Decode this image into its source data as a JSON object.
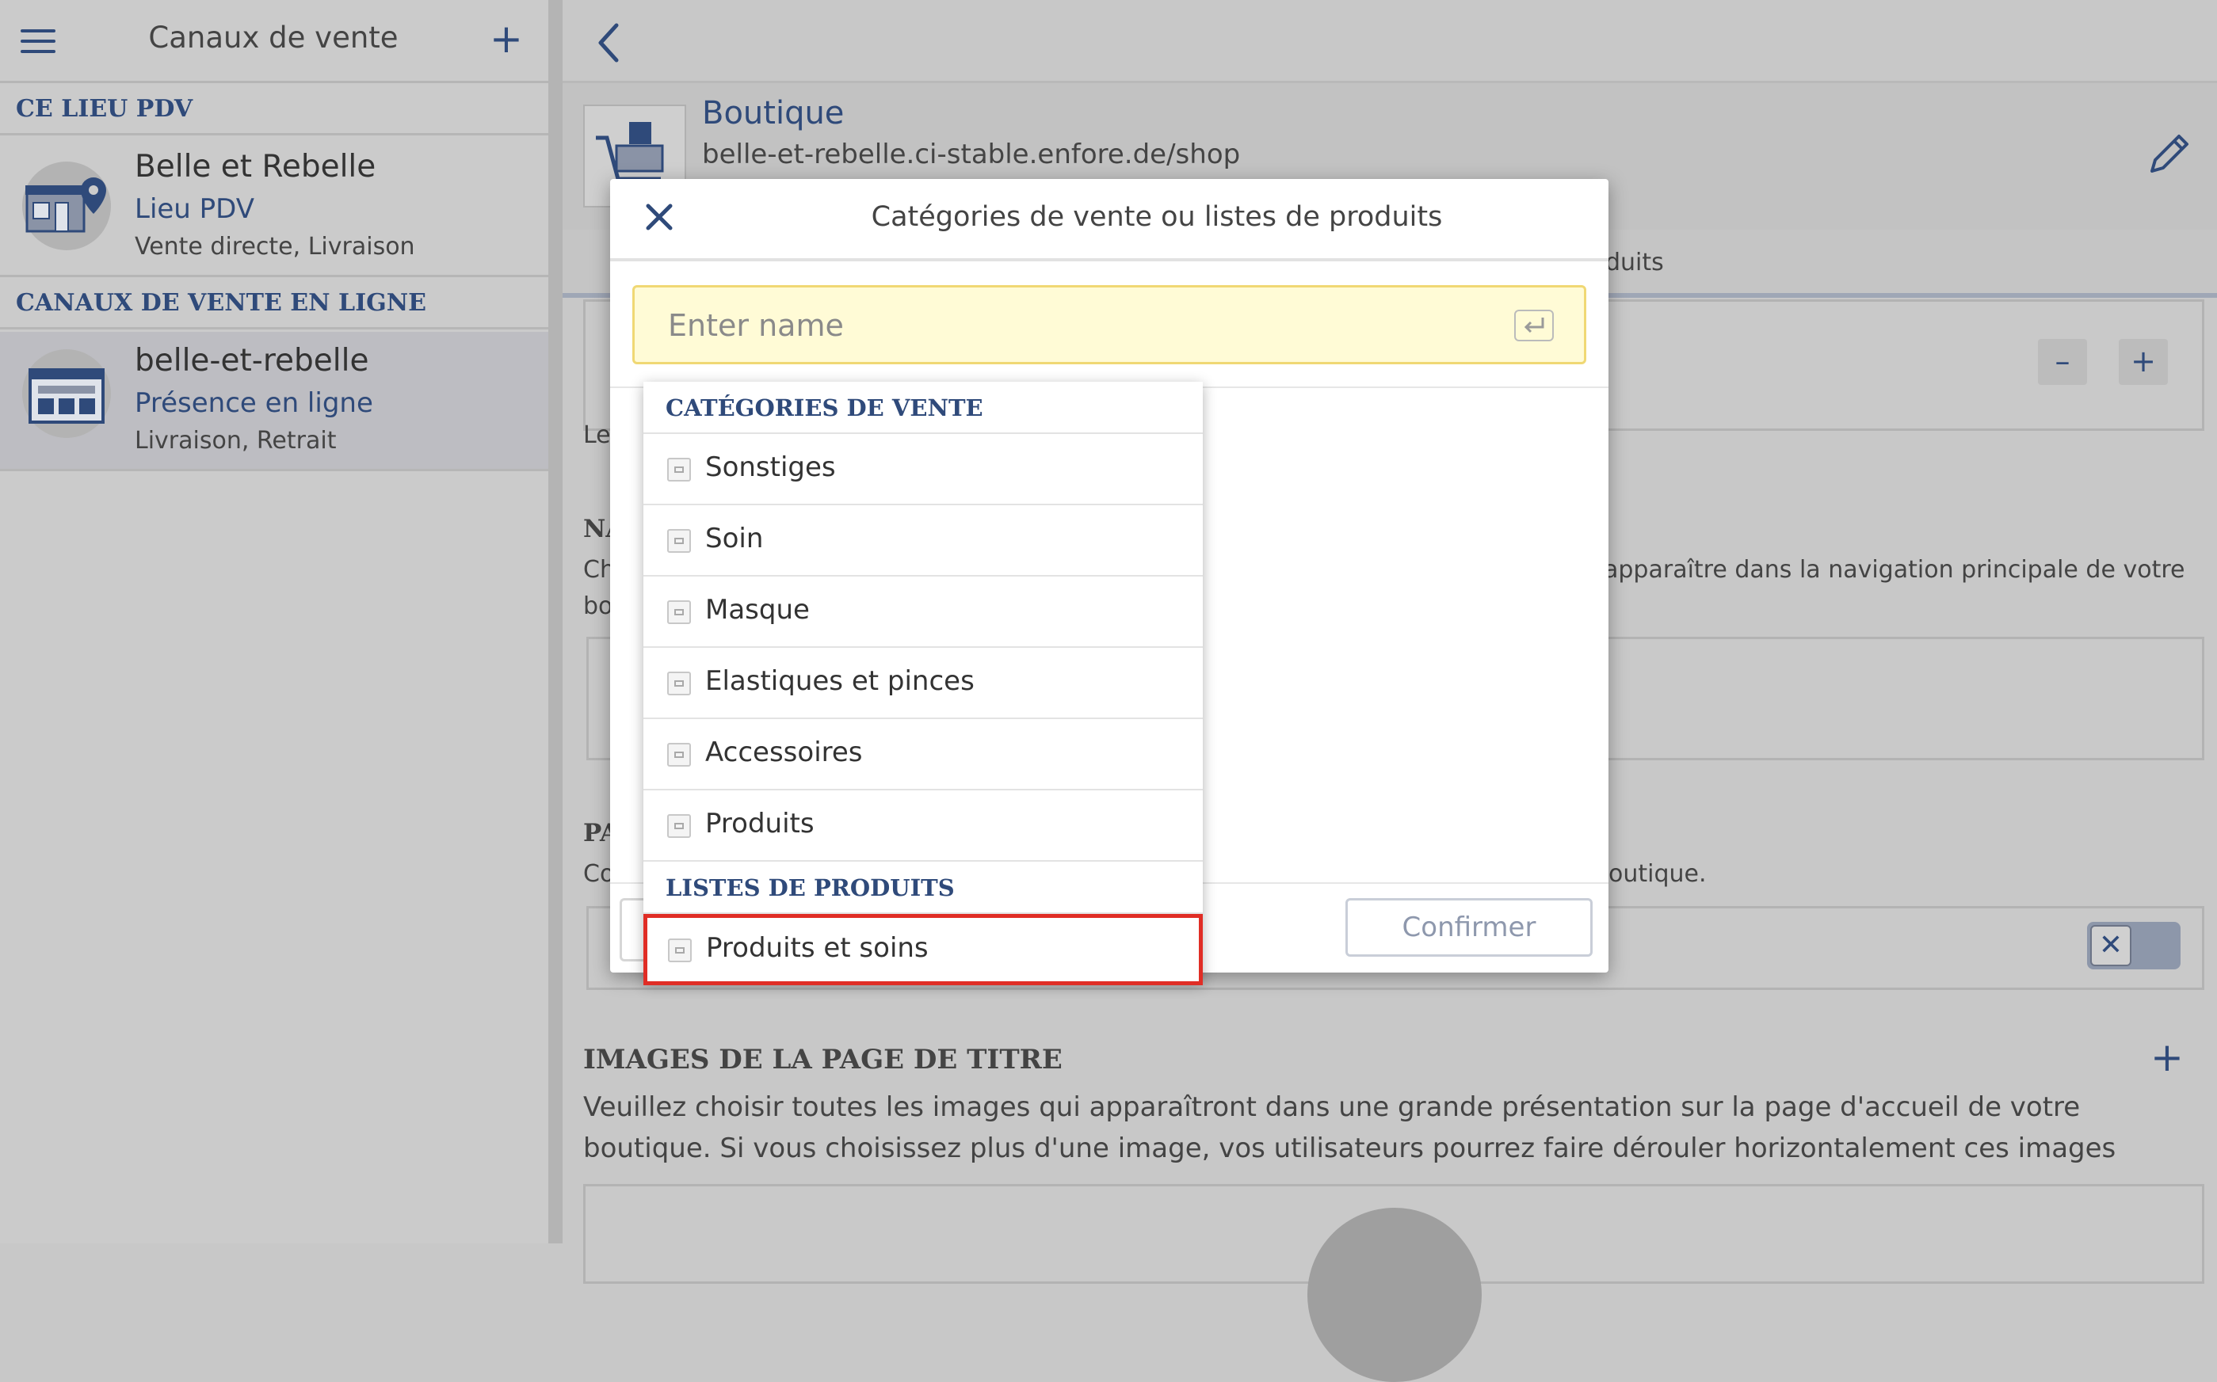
{
  "sidebar": {
    "title": "Canaux de vente",
    "add_label": "+",
    "section_pos": "CE LIEU PDV",
    "section_online": "CANAUX DE VENTE EN LIGNE",
    "items": [
      {
        "title": "Belle et Rebelle",
        "subtitle": "Lieu PDV",
        "meta": "Vente directe, Livraison"
      },
      {
        "title": "belle-et-rebelle",
        "subtitle": "Présence en ligne",
        "meta": "Livraison, Retrait"
      }
    ]
  },
  "main": {
    "shop_title": "Boutique",
    "shop_url": "belle-et-rebelle.ci-stable.enfore.de/shop",
    "tab_fragment": "duits",
    "stepper_minus": "–",
    "stepper_plus": "+",
    "frag_le": "Le",
    "frag_na": "NA",
    "frag_ch": "Ch",
    "frag_bo": "bo",
    "nav_desc_fragment": "apparaître dans la navigation principale de votre",
    "frag_pa": "PA",
    "frag_co": "Co",
    "boutique_fragment": "outique.",
    "images_title": "IMAGES DE LA PAGE DE TITRE",
    "images_add": "+",
    "images_desc": "Veuillez choisir toutes les images qui apparaîtront dans une grande présentation sur la page d'accueil de votre boutique. Si vous choisissez plus d'une image, vos utilisateurs pourrez faire dérouler horizontalement ces images",
    "toggle_symbol": "✕"
  },
  "modal": {
    "title": "Catégories de vente ou listes de produits",
    "input_placeholder": "Enter name",
    "input_value": "",
    "confirm_label": "Confirmer"
  },
  "dropdown": {
    "section_categories": "CATÉGORIES DE VENTE",
    "categories": [
      "Sonstiges",
      "Soin",
      "Masque",
      "Elastiques et pinces",
      "Accessoires",
      "Produits"
    ],
    "section_lists": "LISTES DE PRODUITS",
    "lists": [
      "Produits et soins"
    ]
  },
  "colors": {
    "accent": "#2f4a7a",
    "highlight": "#e02d25",
    "input_bg": "#fffbd6"
  }
}
